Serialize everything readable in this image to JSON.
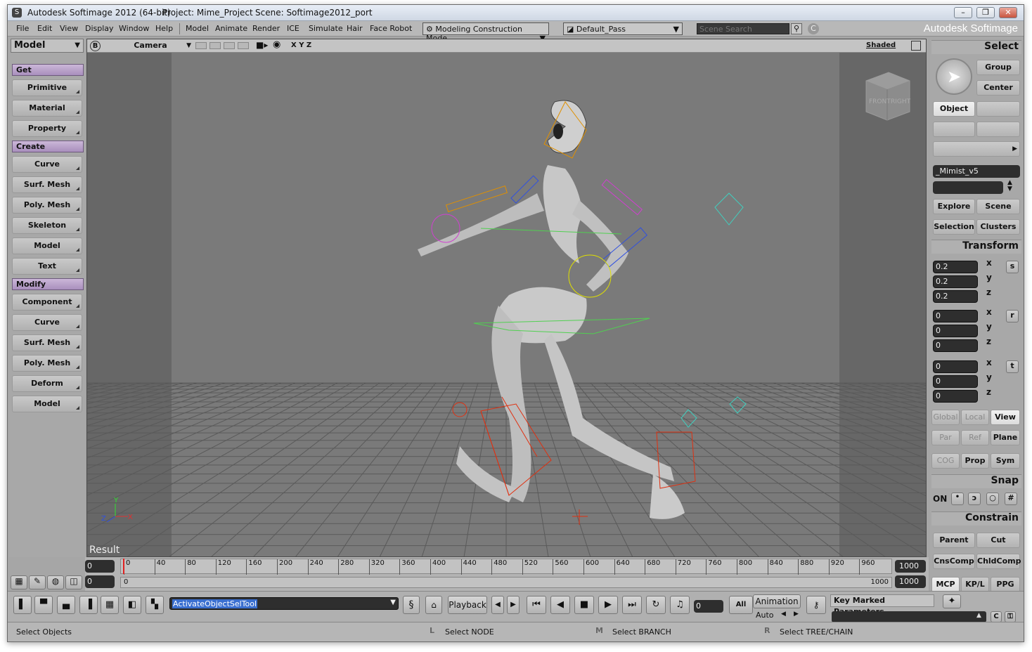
{
  "window": {
    "title": "Autodesk Softimage 2012 (64-bit)",
    "project": "Project: Mime_Project",
    "scene": "Scene: Softimage2012_port",
    "min": "–",
    "max": "❐",
    "close": "✕"
  },
  "menubar": {
    "items": [
      "File",
      "Edit",
      "View",
      "Display",
      "Window",
      "Help",
      "Model",
      "Animate",
      "Render",
      "ICE",
      "Simulate",
      "Hair",
      "Face Robot"
    ],
    "construction_mode": "Modeling Construction Mode",
    "pass": "Default_Pass",
    "search_placeholder": "Scene Search",
    "brand": "Autodesk Softimage"
  },
  "left": {
    "mode": "Model",
    "sections": [
      {
        "title": "Get",
        "buttons": [
          "Primitive",
          "Material",
          "Property"
        ]
      },
      {
        "title": "Create",
        "buttons": [
          "Curve",
          "Surf. Mesh",
          "Poly. Mesh",
          "Skeleton",
          "Model",
          "Text"
        ]
      },
      {
        "title": "Modify",
        "buttons": [
          "Component",
          "Curve",
          "Surf. Mesh",
          "Poly. Mesh",
          "Deform",
          "Model"
        ]
      }
    ]
  },
  "viewport": {
    "badge": "B",
    "camera": "Camera",
    "axes": "X Y Z",
    "display_mode": "Shaded",
    "label": "Result",
    "cube_front": "FRONT",
    "cube_right": "RIGHT",
    "gizmo_y": "Y",
    "gizmo_x": "X",
    "gizmo_z": "Z"
  },
  "right": {
    "select_title": "Select",
    "group": "Group",
    "center": "Center",
    "object": "Object",
    "selection_name": "_Mimist_v5",
    "explore": "Explore",
    "scene": "Scene",
    "selection": "Selection",
    "clusters": "Clusters",
    "transform_title": "Transform",
    "scale": [
      "0.2",
      "0.2",
      "0.2"
    ],
    "rotate": [
      "0",
      "0",
      "0"
    ],
    "translate": [
      "0",
      "0",
      "0"
    ],
    "axes": [
      "x",
      "y",
      "z"
    ],
    "s": "s",
    "r": "r",
    "t": "t",
    "global": "Global",
    "local": "Local",
    "view": "View",
    "par": "Par",
    "ref": "Ref",
    "plane": "Plane",
    "cog": "COG",
    "prop": "Prop",
    "sym": "Sym",
    "snap_title": "Snap",
    "on": "ON",
    "constrain_title": "Constrain",
    "parent": "Parent",
    "cut": "Cut",
    "cnscomp": "CnsComp",
    "childcomp": "ChldComp",
    "tabs": [
      "MCP",
      "KP/L",
      "PPG"
    ]
  },
  "timeline": {
    "start": "0",
    "end": "1000",
    "ticks": [
      "0",
      "40",
      "80",
      "120",
      "160",
      "200",
      "240",
      "280",
      "320",
      "360",
      "400",
      "440",
      "480",
      "520",
      "560",
      "600",
      "640",
      "680",
      "720",
      "760",
      "800",
      "840",
      "880",
      "920",
      "960"
    ],
    "range_start": "0",
    "range_label_start": "0",
    "range_label_end": "1000",
    "range_end": "1000"
  },
  "bottom": {
    "command": "ActivateObjectSelTool",
    "playback": "Playback",
    "frame": "0",
    "all": "All",
    "animation": "Animation",
    "auto": "Auto",
    "key_marked": "Key Marked Parameters"
  },
  "status": {
    "left": "Select Objects",
    "l_key": "L",
    "l_text": "Select NODE",
    "m_key": "M",
    "m_text": "Select BRANCH",
    "r_key": "R",
    "r_text": "Select TREE/CHAIN"
  }
}
